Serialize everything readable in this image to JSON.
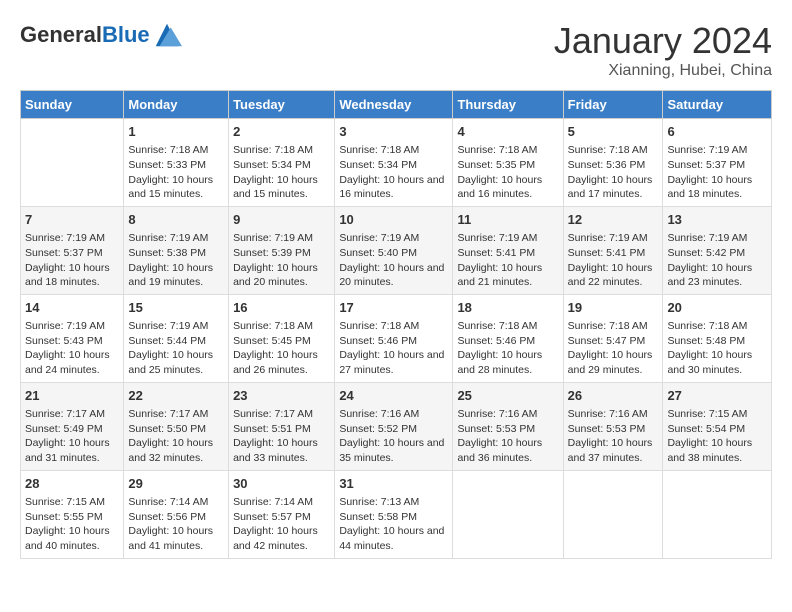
{
  "header": {
    "logo_general": "General",
    "logo_blue": "Blue",
    "main_title": "January 2024",
    "sub_title": "Xianning, Hubei, China"
  },
  "days_of_week": [
    "Sunday",
    "Monday",
    "Tuesday",
    "Wednesday",
    "Thursday",
    "Friday",
    "Saturday"
  ],
  "weeks": [
    [
      {
        "day": null
      },
      {
        "day": 1,
        "sunrise": "7:18 AM",
        "sunset": "5:33 PM",
        "daylight": "10 hours and 15 minutes."
      },
      {
        "day": 2,
        "sunrise": "7:18 AM",
        "sunset": "5:34 PM",
        "daylight": "10 hours and 15 minutes."
      },
      {
        "day": 3,
        "sunrise": "7:18 AM",
        "sunset": "5:34 PM",
        "daylight": "10 hours and 16 minutes."
      },
      {
        "day": 4,
        "sunrise": "7:18 AM",
        "sunset": "5:35 PM",
        "daylight": "10 hours and 16 minutes."
      },
      {
        "day": 5,
        "sunrise": "7:18 AM",
        "sunset": "5:36 PM",
        "daylight": "10 hours and 17 minutes."
      },
      {
        "day": 6,
        "sunrise": "7:19 AM",
        "sunset": "5:37 PM",
        "daylight": "10 hours and 18 minutes."
      }
    ],
    [
      {
        "day": 7,
        "sunrise": "7:19 AM",
        "sunset": "5:37 PM",
        "daylight": "10 hours and 18 minutes."
      },
      {
        "day": 8,
        "sunrise": "7:19 AM",
        "sunset": "5:38 PM",
        "daylight": "10 hours and 19 minutes."
      },
      {
        "day": 9,
        "sunrise": "7:19 AM",
        "sunset": "5:39 PM",
        "daylight": "10 hours and 20 minutes."
      },
      {
        "day": 10,
        "sunrise": "7:19 AM",
        "sunset": "5:40 PM",
        "daylight": "10 hours and 20 minutes."
      },
      {
        "day": 11,
        "sunrise": "7:19 AM",
        "sunset": "5:41 PM",
        "daylight": "10 hours and 21 minutes."
      },
      {
        "day": 12,
        "sunrise": "7:19 AM",
        "sunset": "5:41 PM",
        "daylight": "10 hours and 22 minutes."
      },
      {
        "day": 13,
        "sunrise": "7:19 AM",
        "sunset": "5:42 PM",
        "daylight": "10 hours and 23 minutes."
      }
    ],
    [
      {
        "day": 14,
        "sunrise": "7:19 AM",
        "sunset": "5:43 PM",
        "daylight": "10 hours and 24 minutes."
      },
      {
        "day": 15,
        "sunrise": "7:19 AM",
        "sunset": "5:44 PM",
        "daylight": "10 hours and 25 minutes."
      },
      {
        "day": 16,
        "sunrise": "7:18 AM",
        "sunset": "5:45 PM",
        "daylight": "10 hours and 26 minutes."
      },
      {
        "day": 17,
        "sunrise": "7:18 AM",
        "sunset": "5:46 PM",
        "daylight": "10 hours and 27 minutes."
      },
      {
        "day": 18,
        "sunrise": "7:18 AM",
        "sunset": "5:46 PM",
        "daylight": "10 hours and 28 minutes."
      },
      {
        "day": 19,
        "sunrise": "7:18 AM",
        "sunset": "5:47 PM",
        "daylight": "10 hours and 29 minutes."
      },
      {
        "day": 20,
        "sunrise": "7:18 AM",
        "sunset": "5:48 PM",
        "daylight": "10 hours and 30 minutes."
      }
    ],
    [
      {
        "day": 21,
        "sunrise": "7:17 AM",
        "sunset": "5:49 PM",
        "daylight": "10 hours and 31 minutes."
      },
      {
        "day": 22,
        "sunrise": "7:17 AM",
        "sunset": "5:50 PM",
        "daylight": "10 hours and 32 minutes."
      },
      {
        "day": 23,
        "sunrise": "7:17 AM",
        "sunset": "5:51 PM",
        "daylight": "10 hours and 33 minutes."
      },
      {
        "day": 24,
        "sunrise": "7:16 AM",
        "sunset": "5:52 PM",
        "daylight": "10 hours and 35 minutes."
      },
      {
        "day": 25,
        "sunrise": "7:16 AM",
        "sunset": "5:53 PM",
        "daylight": "10 hours and 36 minutes."
      },
      {
        "day": 26,
        "sunrise": "7:16 AM",
        "sunset": "5:53 PM",
        "daylight": "10 hours and 37 minutes."
      },
      {
        "day": 27,
        "sunrise": "7:15 AM",
        "sunset": "5:54 PM",
        "daylight": "10 hours and 38 minutes."
      }
    ],
    [
      {
        "day": 28,
        "sunrise": "7:15 AM",
        "sunset": "5:55 PM",
        "daylight": "10 hours and 40 minutes."
      },
      {
        "day": 29,
        "sunrise": "7:14 AM",
        "sunset": "5:56 PM",
        "daylight": "10 hours and 41 minutes."
      },
      {
        "day": 30,
        "sunrise": "7:14 AM",
        "sunset": "5:57 PM",
        "daylight": "10 hours and 42 minutes."
      },
      {
        "day": 31,
        "sunrise": "7:13 AM",
        "sunset": "5:58 PM",
        "daylight": "10 hours and 44 minutes."
      },
      {
        "day": null
      },
      {
        "day": null
      },
      {
        "day": null
      }
    ]
  ],
  "labels": {
    "sunrise": "Sunrise:",
    "sunset": "Sunset:",
    "daylight": "Daylight:"
  }
}
